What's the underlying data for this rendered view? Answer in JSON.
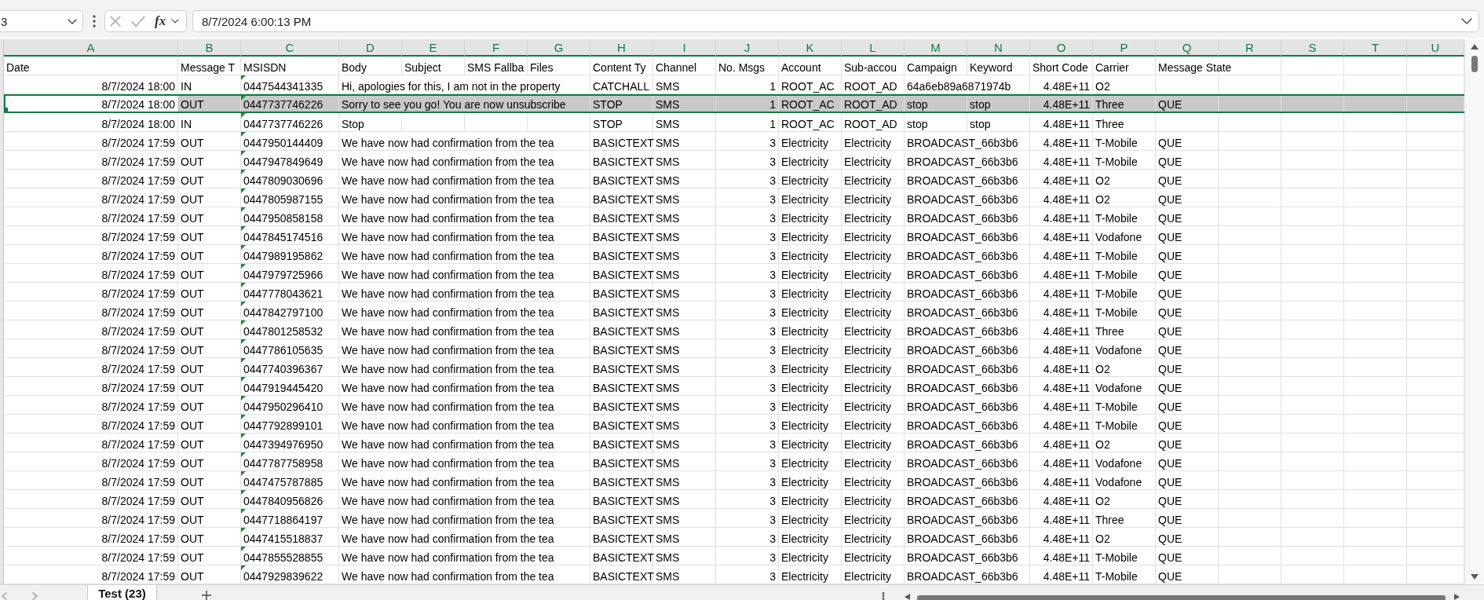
{
  "formula_bar": {
    "name_box": "3",
    "function_label": "fx",
    "formula": "8/7/2024 6:00:13 PM"
  },
  "columns": [
    {
      "letter": "A",
      "selected": true
    },
    {
      "letter": "B",
      "selected": true
    },
    {
      "letter": "C",
      "selected": true
    },
    {
      "letter": "D",
      "selected": true
    },
    {
      "letter": "E",
      "selected": true
    },
    {
      "letter": "F",
      "selected": true
    },
    {
      "letter": "G",
      "selected": true
    },
    {
      "letter": "H",
      "selected": true
    },
    {
      "letter": "I",
      "selected": true
    },
    {
      "letter": "J",
      "selected": true
    },
    {
      "letter": "K",
      "selected": true
    },
    {
      "letter": "L",
      "selected": true
    },
    {
      "letter": "M",
      "selected": true
    },
    {
      "letter": "N",
      "selected": true
    },
    {
      "letter": "O",
      "selected": true
    },
    {
      "letter": "P",
      "selected": true
    },
    {
      "letter": "Q",
      "selected": true
    },
    {
      "letter": "R",
      "selected": true
    },
    {
      "letter": "S",
      "selected": true
    },
    {
      "letter": "T",
      "selected": true
    },
    {
      "letter": "U",
      "selected": true
    }
  ],
  "table": {
    "header_row": {
      "selected": false,
      "cells": {
        "a": "Date",
        "b": "Message T",
        "c": "MSISDN",
        "d": "Body",
        "e": "Subject",
        "f": "SMS Fallba",
        "g": "Files",
        "h": "Content Ty",
        "i": "Channel",
        "j": "No. Msgs",
        "k": "Account",
        "l": "Sub-accou",
        "m": "Campaign",
        "n": "Keyword",
        "o": "Short Code",
        "p": "Carrier",
        "q": "Message State"
      }
    },
    "rows": [
      {
        "selected": false,
        "warning": true,
        "cells": {
          "a": "8/7/2024 18:00",
          "b": "IN",
          "c": "0447544341335",
          "d": "Hi, apologies for this, I am not in the property",
          "h": "CATCHALL",
          "i": "SMS",
          "j": "1",
          "k": "ROOT_AC",
          "l": "ROOT_AD",
          "m": "64a6eb89a6871974b",
          "o": "4.48E+11",
          "p": "O2"
        }
      },
      {
        "selected": true,
        "warning": true,
        "cells": {
          "a": "8/7/2024 18:00",
          "b": "OUT",
          "c": "0447737746226",
          "d": "Sorry to see you go! You are now unsubscribe",
          "h": "STOP",
          "i": "SMS",
          "j": "1",
          "k": "ROOT_AC",
          "l": "ROOT_AD",
          "m": "stop",
          "n": "stop",
          "o": "4.48E+11",
          "p": "Three",
          "q": "QUE"
        }
      },
      {
        "selected": false,
        "warning": true,
        "cells": {
          "a": "8/7/2024 18:00",
          "b": "IN",
          "c": "0447737746226",
          "d": "Stop",
          "h": "STOP",
          "i": "SMS",
          "j": "1",
          "k": "ROOT_AC",
          "l": "ROOT_AD",
          "m": "stop",
          "n": "stop",
          "o": "4.48E+11",
          "p": "Three"
        }
      },
      {
        "selected": false,
        "warning": true,
        "cells": {
          "a": "8/7/2024 17:59",
          "b": "OUT",
          "c": "0447950144409",
          "d": "We have now had confirmation from the tea",
          "h": "BASICTEXT",
          "i": "SMS",
          "j": "3",
          "k": "Electricity",
          "l": "Electricity",
          "m": "BROADCAST_66b3b6",
          "o": "4.48E+11",
          "p": "T-Mobile",
          "q": "QUE"
        }
      },
      {
        "selected": false,
        "warning": true,
        "cells": {
          "a": "8/7/2024 17:59",
          "b": "OUT",
          "c": "0447947849649",
          "d": "We have now had confirmation from the tea",
          "h": "BASICTEXT",
          "i": "SMS",
          "j": "3",
          "k": "Electricity",
          "l": "Electricity",
          "m": "BROADCAST_66b3b6",
          "o": "4.48E+11",
          "p": "T-Mobile",
          "q": "QUE"
        }
      },
      {
        "selected": false,
        "warning": true,
        "cells": {
          "a": "8/7/2024 17:59",
          "b": "OUT",
          "c": "0447809030696",
          "d": "We have now had confirmation from the tea",
          "h": "BASICTEXT",
          "i": "SMS",
          "j": "3",
          "k": "Electricity",
          "l": "Electricity",
          "m": "BROADCAST_66b3b6",
          "o": "4.48E+11",
          "p": "O2",
          "q": "QUE"
        }
      },
      {
        "selected": false,
        "warning": true,
        "cells": {
          "a": "8/7/2024 17:59",
          "b": "OUT",
          "c": "0447805987155",
          "d": "We have now had confirmation from the tea",
          "h": "BASICTEXT",
          "i": "SMS",
          "j": "3",
          "k": "Electricity",
          "l": "Electricity",
          "m": "BROADCAST_66b3b6",
          "o": "4.48E+11",
          "p": "O2",
          "q": "QUE"
        }
      },
      {
        "selected": false,
        "warning": true,
        "cells": {
          "a": "8/7/2024 17:59",
          "b": "OUT",
          "c": "0447950858158",
          "d": "We have now had confirmation from the tea",
          "h": "BASICTEXT",
          "i": "SMS",
          "j": "3",
          "k": "Electricity",
          "l": "Electricity",
          "m": "BROADCAST_66b3b6",
          "o": "4.48E+11",
          "p": "T-Mobile",
          "q": "QUE"
        }
      },
      {
        "selected": false,
        "warning": true,
        "cells": {
          "a": "8/7/2024 17:59",
          "b": "OUT",
          "c": "0447845174516",
          "d": "We have now had confirmation from the tea",
          "h": "BASICTEXT",
          "i": "SMS",
          "j": "3",
          "k": "Electricity",
          "l": "Electricity",
          "m": "BROADCAST_66b3b6",
          "o": "4.48E+11",
          "p": "Vodafone",
          "q": "QUE"
        }
      },
      {
        "selected": false,
        "warning": true,
        "cells": {
          "a": "8/7/2024 17:59",
          "b": "OUT",
          "c": "0447989195862",
          "d": "We have now had confirmation from the tea",
          "h": "BASICTEXT",
          "i": "SMS",
          "j": "3",
          "k": "Electricity",
          "l": "Electricity",
          "m": "BROADCAST_66b3b6",
          "o": "4.48E+11",
          "p": "T-Mobile",
          "q": "QUE"
        }
      },
      {
        "selected": false,
        "warning": true,
        "cells": {
          "a": "8/7/2024 17:59",
          "b": "OUT",
          "c": "0447979725966",
          "d": "We have now had confirmation from the tea",
          "h": "BASICTEXT",
          "i": "SMS",
          "j": "3",
          "k": "Electricity",
          "l": "Electricity",
          "m": "BROADCAST_66b3b6",
          "o": "4.48E+11",
          "p": "T-Mobile",
          "q": "QUE"
        }
      },
      {
        "selected": false,
        "warning": true,
        "cells": {
          "a": "8/7/2024 17:59",
          "b": "OUT",
          "c": "0447778043621",
          "d": "We have now had confirmation from the tea",
          "h": "BASICTEXT",
          "i": "SMS",
          "j": "3",
          "k": "Electricity",
          "l": "Electricity",
          "m": "BROADCAST_66b3b6",
          "o": "4.48E+11",
          "p": "T-Mobile",
          "q": "QUE"
        }
      },
      {
        "selected": false,
        "warning": true,
        "cells": {
          "a": "8/7/2024 17:59",
          "b": "OUT",
          "c": "0447842797100",
          "d": "We have now had confirmation from the tea",
          "h": "BASICTEXT",
          "i": "SMS",
          "j": "3",
          "k": "Electricity",
          "l": "Electricity",
          "m": "BROADCAST_66b3b6",
          "o": "4.48E+11",
          "p": "T-Mobile",
          "q": "QUE"
        }
      },
      {
        "selected": false,
        "warning": true,
        "cells": {
          "a": "8/7/2024 17:59",
          "b": "OUT",
          "c": "0447801258532",
          "d": "We have now had confirmation from the tea",
          "h": "BASICTEXT",
          "i": "SMS",
          "j": "3",
          "k": "Electricity",
          "l": "Electricity",
          "m": "BROADCAST_66b3b6",
          "o": "4.48E+11",
          "p": "Three",
          "q": "QUE"
        }
      },
      {
        "selected": false,
        "warning": true,
        "cells": {
          "a": "8/7/2024 17:59",
          "b": "OUT",
          "c": "0447786105635",
          "d": "We have now had confirmation from the tea",
          "h": "BASICTEXT",
          "i": "SMS",
          "j": "3",
          "k": "Electricity",
          "l": "Electricity",
          "m": "BROADCAST_66b3b6",
          "o": "4.48E+11",
          "p": "Vodafone",
          "q": "QUE"
        }
      },
      {
        "selected": false,
        "warning": true,
        "cells": {
          "a": "8/7/2024 17:59",
          "b": "OUT",
          "c": "0447740396367",
          "d": "We have now had confirmation from the tea",
          "h": "BASICTEXT",
          "i": "SMS",
          "j": "3",
          "k": "Electricity",
          "l": "Electricity",
          "m": "BROADCAST_66b3b6",
          "o": "4.48E+11",
          "p": "O2",
          "q": "QUE"
        }
      },
      {
        "selected": false,
        "warning": true,
        "cells": {
          "a": "8/7/2024 17:59",
          "b": "OUT",
          "c": "0447919445420",
          "d": "We have now had confirmation from the tea",
          "h": "BASICTEXT",
          "i": "SMS",
          "j": "3",
          "k": "Electricity",
          "l": "Electricity",
          "m": "BROADCAST_66b3b6",
          "o": "4.48E+11",
          "p": "Vodafone",
          "q": "QUE"
        }
      },
      {
        "selected": false,
        "warning": true,
        "cells": {
          "a": "8/7/2024 17:59",
          "b": "OUT",
          "c": "0447950296410",
          "d": "We have now had confirmation from the tea",
          "h": "BASICTEXT",
          "i": "SMS",
          "j": "3",
          "k": "Electricity",
          "l": "Electricity",
          "m": "BROADCAST_66b3b6",
          "o": "4.48E+11",
          "p": "T-Mobile",
          "q": "QUE"
        }
      },
      {
        "selected": false,
        "warning": true,
        "cells": {
          "a": "8/7/2024 17:59",
          "b": "OUT",
          "c": "0447792899101",
          "d": "We have now had confirmation from the tea",
          "h": "BASICTEXT",
          "i": "SMS",
          "j": "3",
          "k": "Electricity",
          "l": "Electricity",
          "m": "BROADCAST_66b3b6",
          "o": "4.48E+11",
          "p": "T-Mobile",
          "q": "QUE"
        }
      },
      {
        "selected": false,
        "warning": true,
        "cells": {
          "a": "8/7/2024 17:59",
          "b": "OUT",
          "c": "0447394976950",
          "d": "We have now had confirmation from the tea",
          "h": "BASICTEXT",
          "i": "SMS",
          "j": "3",
          "k": "Electricity",
          "l": "Electricity",
          "m": "BROADCAST_66b3b6",
          "o": "4.48E+11",
          "p": "O2",
          "q": "QUE"
        }
      },
      {
        "selected": false,
        "warning": true,
        "cells": {
          "a": "8/7/2024 17:59",
          "b": "OUT",
          "c": "0447787758958",
          "d": "We have now had confirmation from the tea",
          "h": "BASICTEXT",
          "i": "SMS",
          "j": "3",
          "k": "Electricity",
          "l": "Electricity",
          "m": "BROADCAST_66b3b6",
          "o": "4.48E+11",
          "p": "Vodafone",
          "q": "QUE"
        }
      },
      {
        "selected": false,
        "warning": true,
        "cells": {
          "a": "8/7/2024 17:59",
          "b": "OUT",
          "c": "0447475787885",
          "d": "We have now had confirmation from the tea",
          "h": "BASICTEXT",
          "i": "SMS",
          "j": "3",
          "k": "Electricity",
          "l": "Electricity",
          "m": "BROADCAST_66b3b6",
          "o": "4.48E+11",
          "p": "Vodafone",
          "q": "QUE"
        }
      },
      {
        "selected": false,
        "warning": true,
        "cells": {
          "a": "8/7/2024 17:59",
          "b": "OUT",
          "c": "0447840956826",
          "d": "We have now had confirmation from the tea",
          "h": "BASICTEXT",
          "i": "SMS",
          "j": "3",
          "k": "Electricity",
          "l": "Electricity",
          "m": "BROADCAST_66b3b6",
          "o": "4.48E+11",
          "p": "O2",
          "q": "QUE"
        }
      },
      {
        "selected": false,
        "warning": true,
        "cells": {
          "a": "8/7/2024 17:59",
          "b": "OUT",
          "c": "0447718864197",
          "d": "We have now had confirmation from the tea",
          "h": "BASICTEXT",
          "i": "SMS",
          "j": "3",
          "k": "Electricity",
          "l": "Electricity",
          "m": "BROADCAST_66b3b6",
          "o": "4.48E+11",
          "p": "Three",
          "q": "QUE"
        }
      },
      {
        "selected": false,
        "warning": true,
        "cells": {
          "a": "8/7/2024 17:59",
          "b": "OUT",
          "c": "0447415518837",
          "d": "We have now had confirmation from the tea",
          "h": "BASICTEXT",
          "i": "SMS",
          "j": "3",
          "k": "Electricity",
          "l": "Electricity",
          "m": "BROADCAST_66b3b6",
          "o": "4.48E+11",
          "p": "O2",
          "q": "QUE"
        }
      },
      {
        "selected": false,
        "warning": true,
        "cells": {
          "a": "8/7/2024 17:59",
          "b": "OUT",
          "c": "0447855528855",
          "d": "We have now had confirmation from the tea",
          "h": "BASICTEXT",
          "i": "SMS",
          "j": "3",
          "k": "Electricity",
          "l": "Electricity",
          "m": "BROADCAST_66b3b6",
          "o": "4.48E+11",
          "p": "T-Mobile",
          "q": "QUE"
        }
      },
      {
        "selected": false,
        "warning": true,
        "cells": {
          "a": "8/7/2024 17:59",
          "b": "OUT",
          "c": "0447929839622",
          "d": "We have now had confirmation from the tea",
          "h": "BASICTEXT",
          "i": "SMS",
          "j": "3",
          "k": "Electricity",
          "l": "Electricity",
          "m": "BROADCAST_66b3b6",
          "o": "4.48E+11",
          "p": "T-Mobile",
          "q": "QUE"
        }
      }
    ]
  },
  "sheet_tabs": [
    {
      "label": "Test (23)",
      "selected": true
    }
  ]
}
